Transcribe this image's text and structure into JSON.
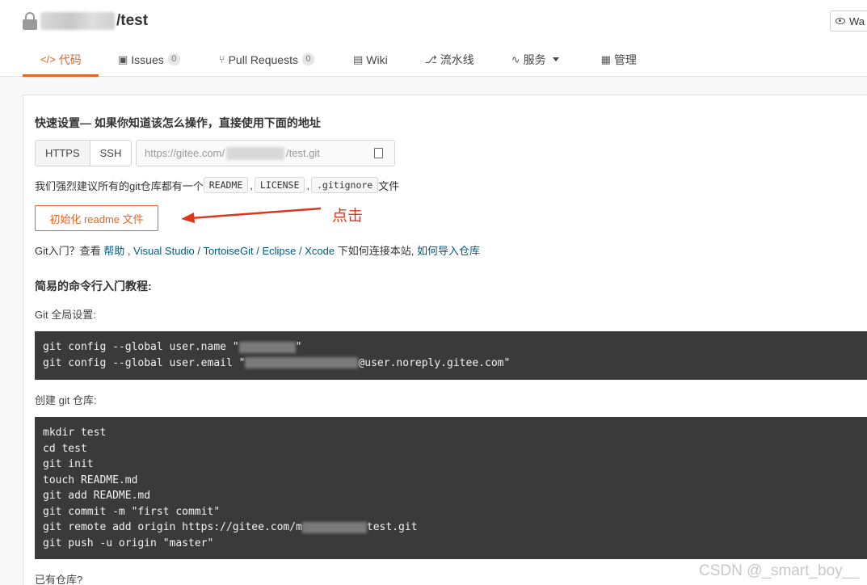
{
  "repo": {
    "name": "/test"
  },
  "watch_button": {
    "label": "Wa"
  },
  "tabs": [
    {
      "icon": "</>",
      "label": "代码"
    },
    {
      "icon": "▣",
      "label": "Issues",
      "count": "0"
    },
    {
      "icon": "⑂",
      "label": "Pull Requests",
      "count": "0"
    },
    {
      "icon": "▤",
      "label": "Wiki"
    },
    {
      "icon": "⎇",
      "label": "流水线"
    },
    {
      "icon": "∿",
      "label": "服务"
    },
    {
      "icon": "▦",
      "label": "管理"
    }
  ],
  "quick_setup": {
    "title": "快速设置— 如果你知道该怎么操作，直接使用下面的地址",
    "protocols": [
      "HTTPS",
      "SSH"
    ],
    "url_prefix": "https://gitee.com/",
    "url_suffix": "/test.git",
    "recommend_text": "我们强烈建议所有的git仓库都有一个",
    "files": [
      "README",
      "LICENSE",
      ".gitignore"
    ],
    "recommend_suffix": "文件",
    "sep": ",",
    "init_button": "初始化 readme 文件",
    "click_note": "点击"
  },
  "git_intro": {
    "prefix": "Git入门？查看",
    "help": "帮助",
    "sep1": ",",
    "tools": [
      "Visual Studio",
      "TortoiseGit",
      "Eclipse",
      "Xcode"
    ],
    "slash": "/",
    "connect_text": "下如何连接本站,",
    "import_link": "如何导入仓库"
  },
  "tutorial": {
    "title": "简易的命令行入门教程:",
    "global_label": "Git 全局设置:",
    "global_lines": [
      {
        "before": "git config --global user.name \"",
        "after": "\""
      },
      {
        "before": "git config --global user.email \"",
        "after": "@user.noreply.gitee.com\""
      }
    ],
    "create_label": "创建 git 仓库:",
    "create_lines": [
      "mkdir test",
      "cd test",
      "git init",
      "touch README.md",
      "git add README.md",
      "git commit -m \"first commit\""
    ],
    "remote_before": "git remote add origin https://gitee.com/m",
    "remote_after": "test.git",
    "push_line": "git push -u origin \"master\"",
    "existing_label": "已有仓库?"
  },
  "watermark": "CSDN @_smart_boy__",
  "colors": {
    "accent": "#e66525",
    "link": "#005980",
    "code_bg": "#3a3a3a",
    "annotation": "#e0341b"
  }
}
